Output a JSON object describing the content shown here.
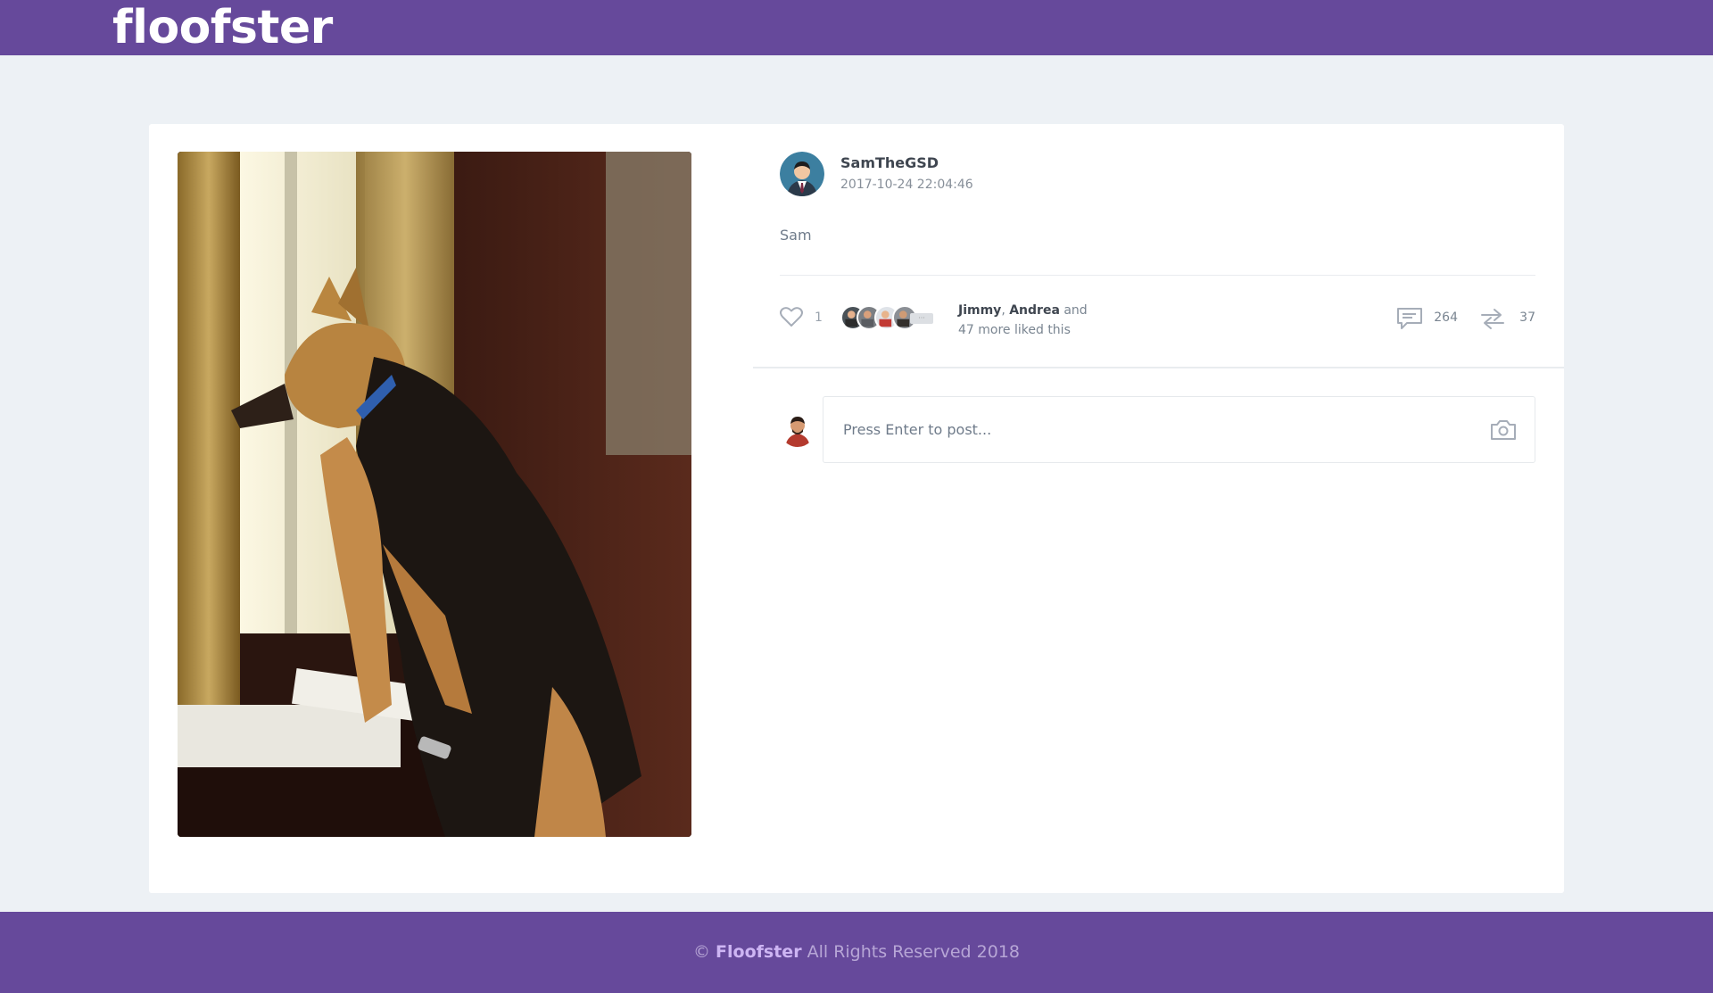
{
  "header": {
    "brand": "floofster"
  },
  "post": {
    "author": "SamTheGSD",
    "timestamp": "2017-10-24 22:04:46",
    "text": "Sam",
    "likes": {
      "count": "1",
      "liked_by_1": "Jimmy",
      "separator": ", ",
      "liked_by_2": "Andrea",
      "and": " and",
      "more": "47 more liked this"
    },
    "comments_count": "264",
    "shares_count": "37"
  },
  "composer": {
    "placeholder": "Press Enter to post..."
  },
  "footer": {
    "copyright": "©",
    "brand": "Floofster",
    "rights": "All Rights Reserved 2018"
  },
  "colors": {
    "brand_purple": "#66499b",
    "background": "#edf1f5",
    "card": "#ffffff"
  },
  "icons": [
    "heart-icon",
    "comment-icon",
    "share-icon",
    "camera-icon"
  ]
}
